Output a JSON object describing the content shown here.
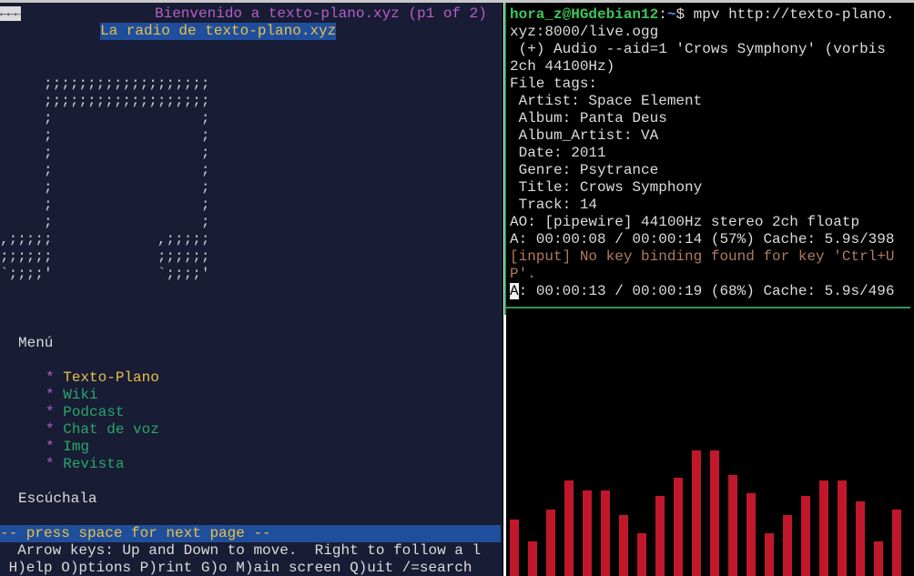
{
  "left": {
    "back_arrow": "←←←",
    "page_header": "Bienvenido a texto-plano.xyz (p1 of 2)",
    "radio_title": "La radio de texto-plano.xyz",
    "ascii_art": "     ;;;;;;;;;;;;;;;;;;;\n     ;;;;;;;;;;;;;;;;;;;\n     ;                 ;\n     ;                 ;\n     ;                 ;\n     ;                 ;\n     ;                 ;\n     ;                 ;\n     ;                 ;\n,;;;;;            ,;;;;;\n;;;;;;            ;;;;;;\n`;;;;'            `;;;;'",
    "menu_heading": "Menú",
    "menu_bullet": "*",
    "menu_items": [
      "Texto-Plano",
      "Wiki",
      "Podcast",
      "Chat de voz",
      "Img",
      "Revista"
    ],
    "listen_heading": "Escúchala",
    "status": "-- press space for next page --",
    "help_line_1": "  Arrow keys: Up and Down to move.  Right to follow a l",
    "help_line_2": " H)elp O)ptions P)rint G)o M)ain screen Q)uit /=search"
  },
  "terminal": {
    "prompt_user": "hora_z@HGdebian12",
    "prompt_sep": ":",
    "prompt_path": "~",
    "prompt_symbol": "$",
    "command": " mpv http://texto-plano.",
    "command_cont": "xyz:8000/live.ogg",
    "audio_line": " (+) Audio --aid=1 'Crows Symphony' (vorbis",
    "audio_line_cont": "2ch 44100Hz)",
    "file_tags_label": "File tags:",
    "tags": [
      " Artist: Space Element",
      " Album: Panta Deus",
      " Album_Artist: VA",
      " Date: 2011",
      " Genre: Psytrance",
      " Title: Crows Symphony",
      " Track: 14"
    ],
    "ao_line": "AO: [pipewire] 44100Hz stereo 2ch floatp",
    "progress_1": "A: 00:00:08 / 00:00:14 (57%) Cache: 5.9s/398",
    "warning_1": "[input] No key binding found for key 'Ctrl+U",
    "warning_2": "P'.",
    "progress_2_cursor": "A",
    "progress_2_rest": ": 00:00:13 / 00:00:19 (68%) Cache: 5.9s/496"
  },
  "visualizer": {
    "bar_color": "#c0182a",
    "levels": [
      0.21,
      0.13,
      0.25,
      0.36,
      0.32,
      0.32,
      0.23,
      0.16,
      0.3,
      0.37,
      0.47,
      0.47,
      0.38,
      0.31,
      0.16,
      0.23,
      0.3,
      0.36,
      0.36,
      0.28,
      0.13,
      0.25
    ]
  }
}
